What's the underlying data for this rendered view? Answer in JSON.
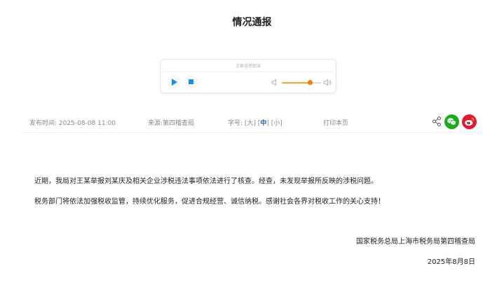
{
  "page": {
    "title": "情况通报"
  },
  "player": {
    "notice": "文章语音朗读",
    "volume_level": 0.72,
    "volume_color": "#f57c00",
    "play_icon": "play-icon",
    "stop_icon": "stop-icon"
  },
  "meta": {
    "date_label": "发布时间:",
    "date_value": "2025-08-08 11:00",
    "source_label": "来源:",
    "source_value": "第四稽查局",
    "size_label": "字号:",
    "size_large": "大",
    "size_medium": "中",
    "size_small": "小",
    "print_label": "打印本页"
  },
  "share": {
    "share_icon": "share-icon",
    "wechat_icon": "wechat-icon",
    "weibo_icon": "weibo-icon"
  },
  "content": {
    "paragraph1": "近期，我局对王某举报刘某庆及相关企业涉税违法事项依法进行了核查。经查，未发现举报所反映的涉税问题。",
    "paragraph2": "税务部门将依法加强税收监管，持续优化服务，促进合规经营、诚信纳税。感谢社会各界对税收工作的关心支持！",
    "signature_org": "国家税务总局上海市税务局第四稽查局",
    "signature_date": "2025年8月8日"
  }
}
